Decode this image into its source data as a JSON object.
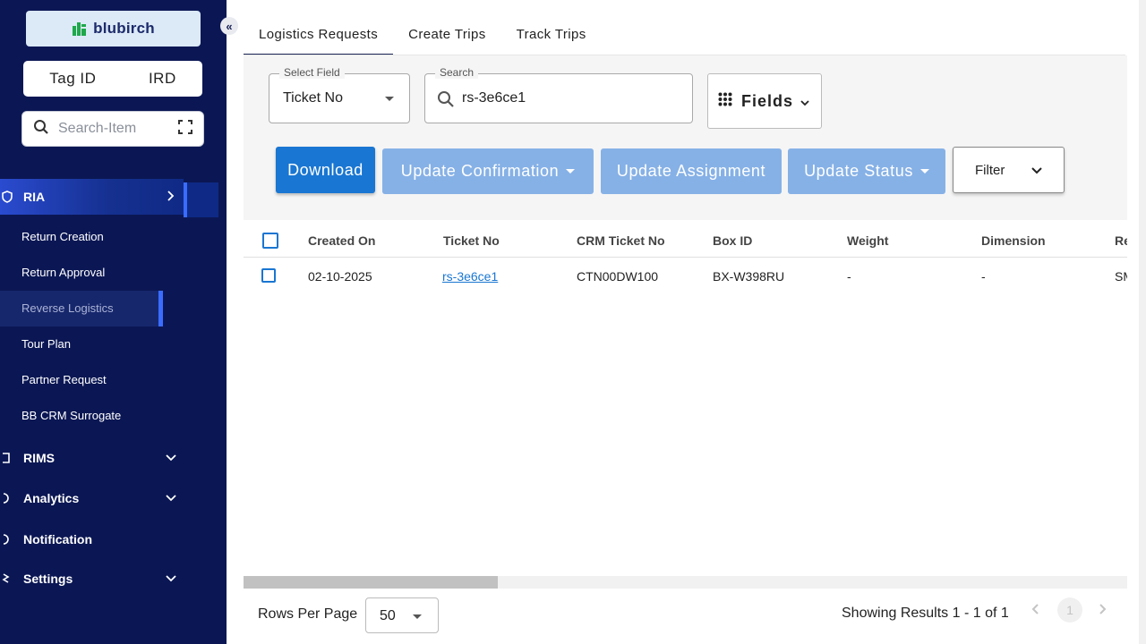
{
  "sidebar": {
    "brand": "blubirch",
    "toggle": [
      "Tag ID",
      "IRD"
    ],
    "search_placeholder": "Search-Item",
    "groups": {
      "ria": "RIA",
      "rims": "RIMS",
      "analytics": "Analytics",
      "notification": "Notification",
      "settings": "Settings"
    },
    "ria_items": [
      "Return Creation",
      "Return Approval",
      "Reverse Logistics",
      "Tour Plan",
      "Partner Request",
      "BB CRM Surrogate"
    ],
    "active_item": "Reverse Logistics"
  },
  "tabs": [
    "Logistics Requests",
    "Create Trips",
    "Track Trips"
  ],
  "active_tab": "Logistics Requests",
  "filters": {
    "select_field_label": "Select Field",
    "select_field_value": "Ticket No",
    "search_label": "Search",
    "search_value": "rs-3e6ce1",
    "fields_label": "Fields"
  },
  "actions": {
    "download": "Download",
    "update_confirmation": "Update Confirmation",
    "update_assignment": "Update Assignment",
    "update_status": "Update Status",
    "filter": "Filter"
  },
  "table": {
    "columns": [
      "Created On",
      "Ticket No",
      "CRM Ticket No",
      "Box ID",
      "Weight",
      "Dimension",
      "Re"
    ],
    "rows": [
      [
        "02-10-2025",
        "rs-3e6ce1",
        "CTN00DW100",
        "BX-W398RU",
        "-",
        "-",
        "SM"
      ]
    ]
  },
  "pagination": {
    "rows_per_page_label": "Rows Per Page",
    "rows_per_page": "50",
    "results": "Showing Results 1 - 1 of 1",
    "current_page": "1"
  },
  "colors": {
    "sidebar_bg": "#0b1754",
    "primary": "#1976d2",
    "primary_muted": "#86b1e6",
    "accent": "#3a6cff"
  }
}
